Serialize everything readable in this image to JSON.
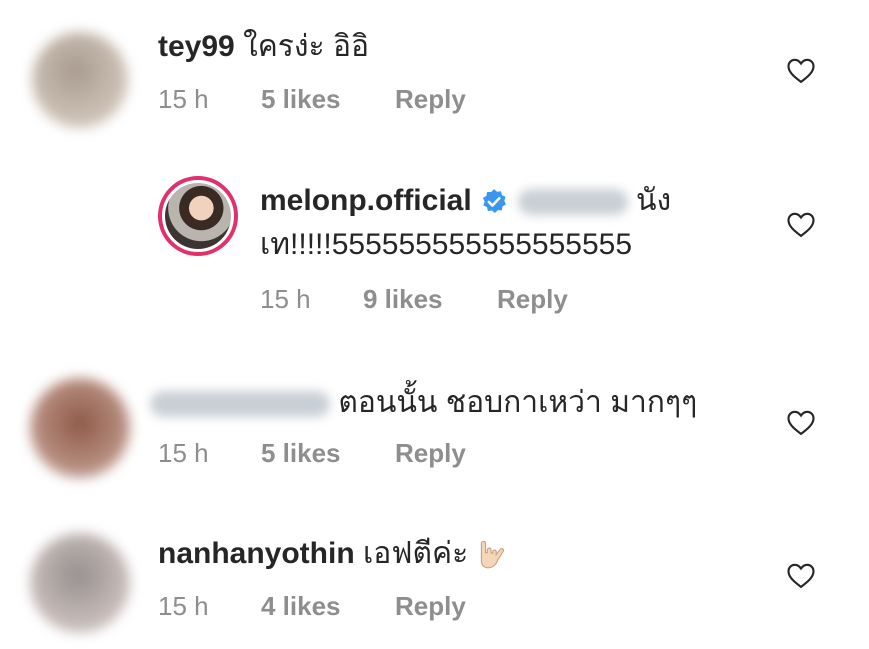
{
  "comments": [
    {
      "username": "tey99",
      "text": "ใครง่ะ อิอิ",
      "time": "15 h",
      "likes": "5 likes",
      "reply": "Reply"
    },
    {
      "username": "melonp.official",
      "verified": true,
      "text_line1": "นัง",
      "text_line2": "เท!!!!!555555555555555555",
      "time": "15 h",
      "likes": "9 likes",
      "reply": "Reply"
    },
    {
      "username": "",
      "text": "ตอนนั้น ชอบกาเหว่า มากๆๆ",
      "time": "15 h",
      "likes": "5 likes",
      "reply": "Reply"
    },
    {
      "username": "nanhanyothin",
      "text": "เอฟตีค่ะ",
      "time": "15 h",
      "likes": "4 likes",
      "reply": "Reply"
    }
  ],
  "icons": {
    "like": "heart-outline-icon",
    "verified": "verified-badge-icon",
    "emoji": "love-you-gesture-emoji"
  },
  "colors": {
    "text": "#262626",
    "meta": "#8e8e8e",
    "verified": "#3897f0",
    "story_ring": "#e1306c"
  }
}
